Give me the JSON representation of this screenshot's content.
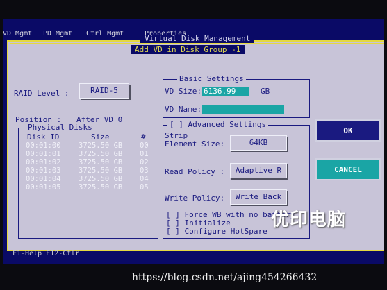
{
  "menu": {
    "items": [
      "VD Mgmt",
      "PD Mgmt",
      "Ctrl Mgmt",
      "Properties"
    ]
  },
  "dialog": {
    "outer_title": "Virtual Disk Management",
    "inner_title": "Add VD in Disk Group -1"
  },
  "raid": {
    "label": "RAID Level :",
    "value": "RAID-5"
  },
  "position": {
    "label": "Position :",
    "value": "After VD 0"
  },
  "physical_disks": {
    "label": "Physical Disks",
    "headers": [
      "Disk ID",
      "Size",
      "#"
    ],
    "rows": [
      [
        "00:01:00",
        "3725.50 GB",
        "00"
      ],
      [
        "00:01:01",
        "3725.50 GB",
        "01"
      ],
      [
        "00:01:02",
        "3725.50 GB",
        "02"
      ],
      [
        "00:01:03",
        "3725.50 GB",
        "03"
      ],
      [
        "00:01:04",
        "3725.50 GB",
        "04"
      ],
      [
        "00:01:05",
        "3725.50 GB",
        "05"
      ]
    ]
  },
  "basic": {
    "label": "Basic Settings",
    "vd_size_label": "VD Size:",
    "vd_size_value": "6136.99",
    "vd_size_unit": "GB",
    "vd_name_label": "VD Name:",
    "vd_name_value": ""
  },
  "advanced": {
    "label": "[ ] Advanced Settings",
    "strip_label_1": "Strip",
    "strip_label_2": "Element Size:",
    "strip_value": "64KB",
    "read_label": "Read Policy :",
    "read_value": "Adaptive R",
    "write_label": "Write Policy:",
    "write_value": "Write Back",
    "checkboxes": [
      "[ ] Force WB with no battery",
      "[ ] Initialize",
      "[ ] Configure HotSpare"
    ]
  },
  "buttons": {
    "ok": "OK",
    "cancel": "CANCEL"
  },
  "status": {
    "text": "F1-Help F12-Ctlr"
  },
  "watermark": {
    "text": "优印电脑"
  },
  "url": {
    "text": "https://blog.csdn.net/ajing454266432"
  },
  "colors": {
    "screen_bg": "#0a0a66",
    "dialog_bg": "#c8c4d8",
    "field_cyan": "#1aa5a5",
    "border_yellow": "#e4d840",
    "ok_bg": "#1a1a80",
    "cancel_bg": "#1aa5a5"
  }
}
